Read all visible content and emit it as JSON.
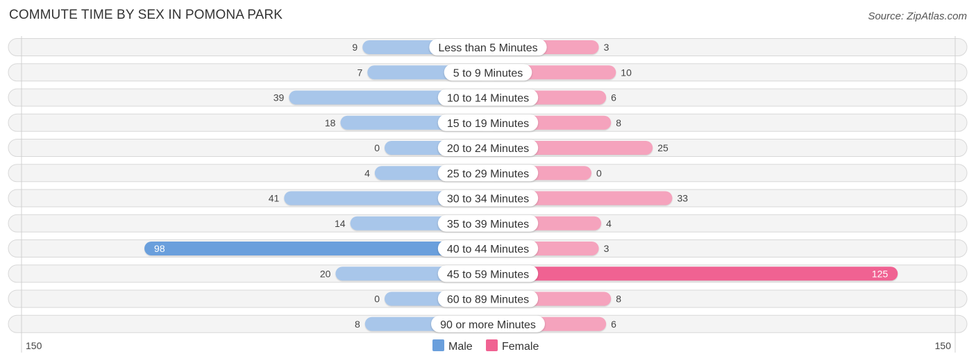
{
  "header": {
    "title": "COMMUTE TIME BY SEX IN POMONA PARK",
    "source": "Source: ZipAtlas.com"
  },
  "chart_data": {
    "type": "bar",
    "orientation": "horizontal-diverging",
    "title": "COMMUTE TIME BY SEX IN POMONA PARK",
    "categories": [
      "Less than 5 Minutes",
      "5 to 9 Minutes",
      "10 to 14 Minutes",
      "15 to 19 Minutes",
      "20 to 24 Minutes",
      "25 to 29 Minutes",
      "30 to 34 Minutes",
      "35 to 39 Minutes",
      "40 to 44 Minutes",
      "45 to 59 Minutes",
      "60 to 89 Minutes",
      "90 or more Minutes"
    ],
    "series": [
      {
        "name": "Male",
        "color": "#6a9fdc",
        "color_light": "#a8c6ea",
        "side": "left",
        "values": [
          9,
          7,
          39,
          18,
          0,
          4,
          41,
          14,
          98,
          20,
          0,
          8
        ]
      },
      {
        "name": "Female",
        "color": "#f06292",
        "color_light": "#f5a3bd",
        "side": "right",
        "values": [
          3,
          10,
          6,
          8,
          25,
          0,
          33,
          4,
          3,
          125,
          8,
          6
        ]
      }
    ],
    "axis": {
      "left_tick": "150",
      "right_tick": "150",
      "max": 150
    },
    "legend": {
      "position": "bottom-center",
      "entries": [
        "Male",
        "Female"
      ]
    },
    "grid": false
  }
}
